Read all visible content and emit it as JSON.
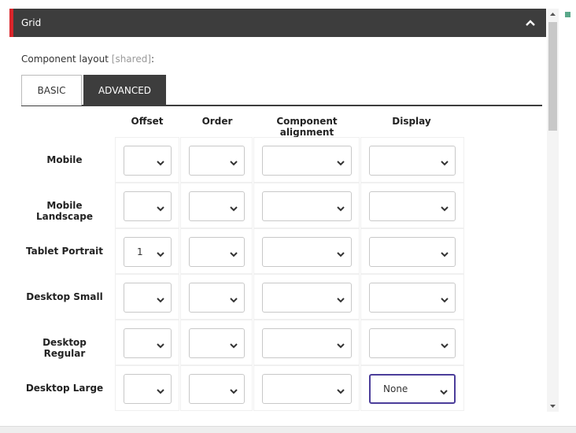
{
  "panel": {
    "title": "Grid"
  },
  "layout_label": {
    "prefix": "Component layout",
    "shared": "[shared]",
    "suffix": ":"
  },
  "tabs": [
    {
      "label": "BASIC",
      "active": false
    },
    {
      "label": "ADVANCED",
      "active": true
    }
  ],
  "columns": [
    "Offset",
    "Order",
    "Component alignment",
    "Display"
  ],
  "rows": [
    {
      "label": "Mobile",
      "values": [
        "",
        "",
        "",
        ""
      ]
    },
    {
      "label": "Mobile Landscape",
      "values": [
        "",
        "",
        "",
        ""
      ]
    },
    {
      "label": "Tablet Portrait",
      "values": [
        "1",
        "",
        "",
        ""
      ]
    },
    {
      "label": "Desktop Small",
      "values": [
        "",
        "",
        "",
        ""
      ]
    },
    {
      "label": "Desktop Regular",
      "values": [
        "",
        "",
        "",
        ""
      ]
    },
    {
      "label": "Desktop Large",
      "values": [
        "",
        "",
        "",
        "None"
      ]
    }
  ],
  "colors": {
    "header_bg": "#3d3d3d",
    "accent": "#d9252b",
    "focus": "#4b3d9a",
    "status": "#5aa88a"
  }
}
